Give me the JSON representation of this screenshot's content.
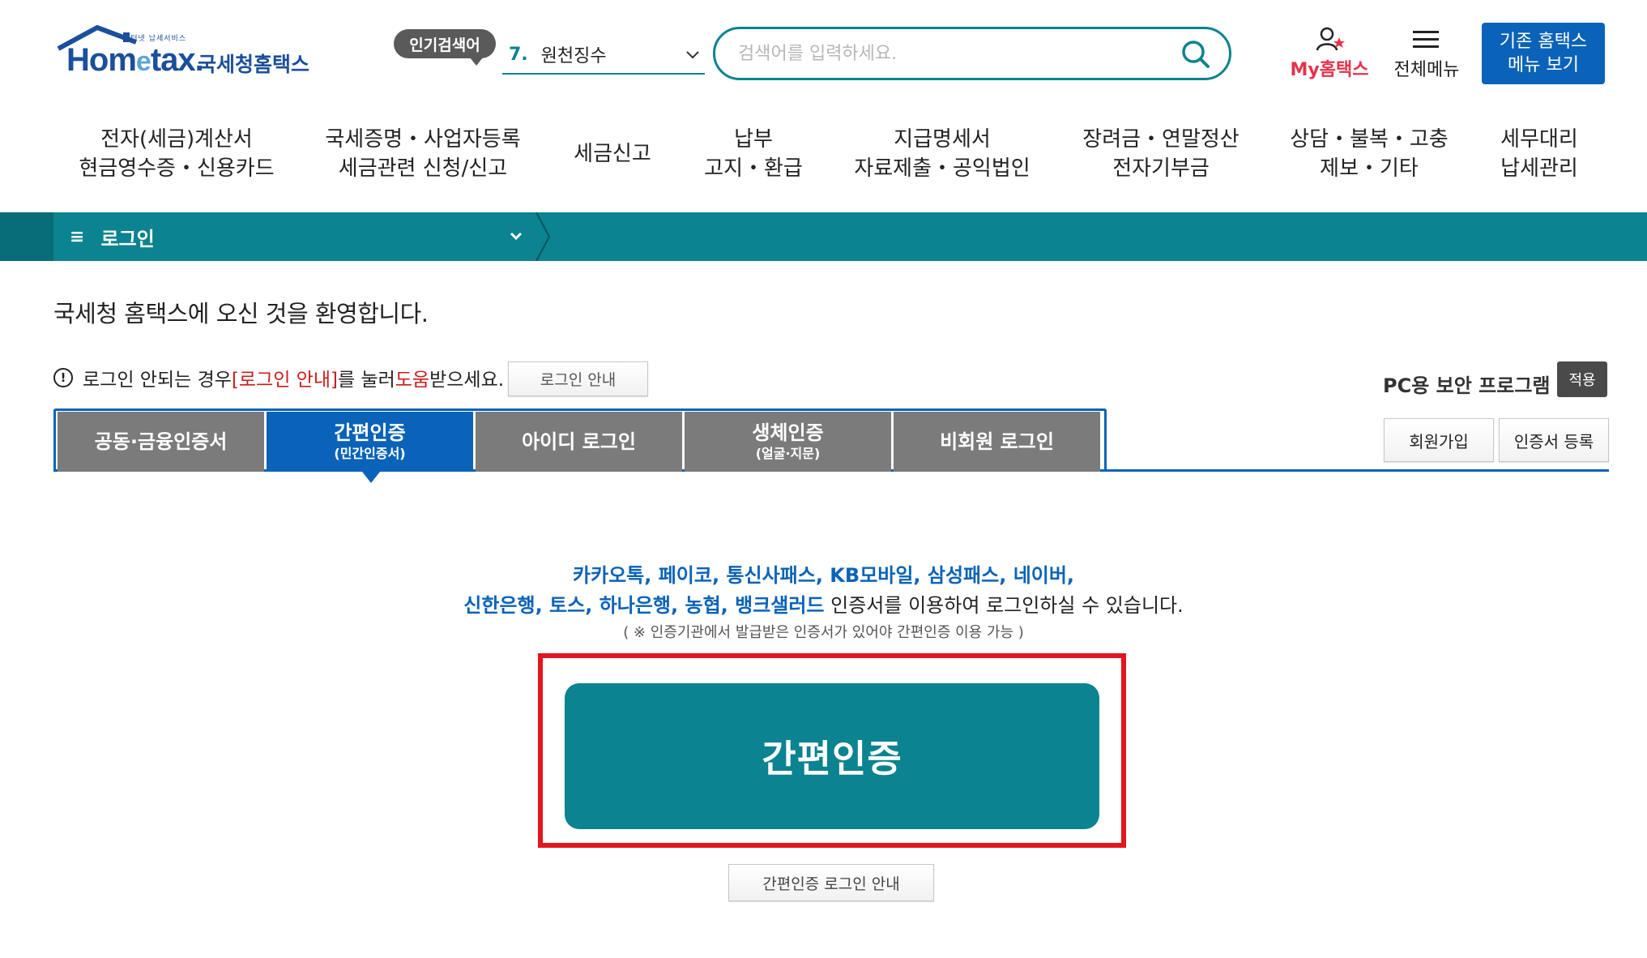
{
  "header": {
    "logo": {
      "tagline": "인터넷 납세서비스",
      "brand_prefix": "Hom",
      "brand_e": "e",
      "brand_suffix": "tax.",
      "brand_ko": "국세청홈택스"
    },
    "popular": {
      "badge": "인기검색어",
      "rank": "7.",
      "keyword": "원천징수"
    },
    "search": {
      "placeholder": "검색어를 입력하세요."
    },
    "my_hometax": "My홈택스",
    "all_menu": "전체메뉴",
    "old_menu": {
      "line1": "기존 홈택스",
      "line2": "메뉴 보기"
    }
  },
  "gnb": [
    {
      "line1": "전자(세금)계산서",
      "line2": "현금영수증・신용카드"
    },
    {
      "line1": "국세증명・사업자등록",
      "line2": "세금관련 신청/신고"
    },
    {
      "line1": "세금신고",
      "line2": ""
    },
    {
      "line1": "납부",
      "line2": "고지・환급"
    },
    {
      "line1": "지급명세서",
      "line2": "자료제출・공익법인"
    },
    {
      "line1": "장려금・연말정산",
      "line2": "전자기부금"
    },
    {
      "line1": "상담・불복・고충",
      "line2": "제보・기타"
    },
    {
      "line1": "세무대리",
      "line2": "납세관리"
    }
  ],
  "location": {
    "current": "로그인"
  },
  "content": {
    "welcome": "국세청 홈택스에 오신 것을 환영합니다.",
    "notice": {
      "pre": "로그인 안되는 경우 ",
      "red1": "[로그인 안내]",
      "mid": "를 눌러 ",
      "red2": "도움",
      "post": "받으세요."
    },
    "login_guide_button": "로그인 안내",
    "pc_security": "PC용 보안 프로그램",
    "apply_button": "적용",
    "tabs": [
      {
        "label": "공동·금융인증서",
        "sub": ""
      },
      {
        "label": "간편인증",
        "sub": "(민간인증서)"
      },
      {
        "label": "아이디 로그인",
        "sub": ""
      },
      {
        "label": "생체인증",
        "sub": "(얼굴·지문)"
      },
      {
        "label": "비회원 로그인",
        "sub": ""
      }
    ],
    "signup_button": "회원가입",
    "cert_register_button": "인증서 등록",
    "providers": {
      "line1_blue": "카카오톡, 페이코, 통신사패스, KB모바일, 삼성패스, 네이버,",
      "line2_blue": "신한은행, 토스, 하나은행, 농협, 뱅크샐러드",
      "line2_rest": " 인증서를 이용하여 로그인하실 수 있습니다.",
      "note": "( ※ 인증기관에서 발급받은 인증서가 있어야 간편인증 이용 가능 )"
    },
    "easy_auth_button": "간편인증",
    "easy_auth_guide_button": "간편인증 로그인 안내"
  },
  "colors": {
    "teal": "#0b8390",
    "blue": "#0a63b8",
    "red_highlight": "#e3151e",
    "tab_gray": "#7b7b7b"
  },
  "icons": {
    "search": "search-icon",
    "user": "user-star-icon",
    "menu": "hamburger-icon",
    "info": "info-circle-icon",
    "chevron": "chevron-down-icon"
  }
}
